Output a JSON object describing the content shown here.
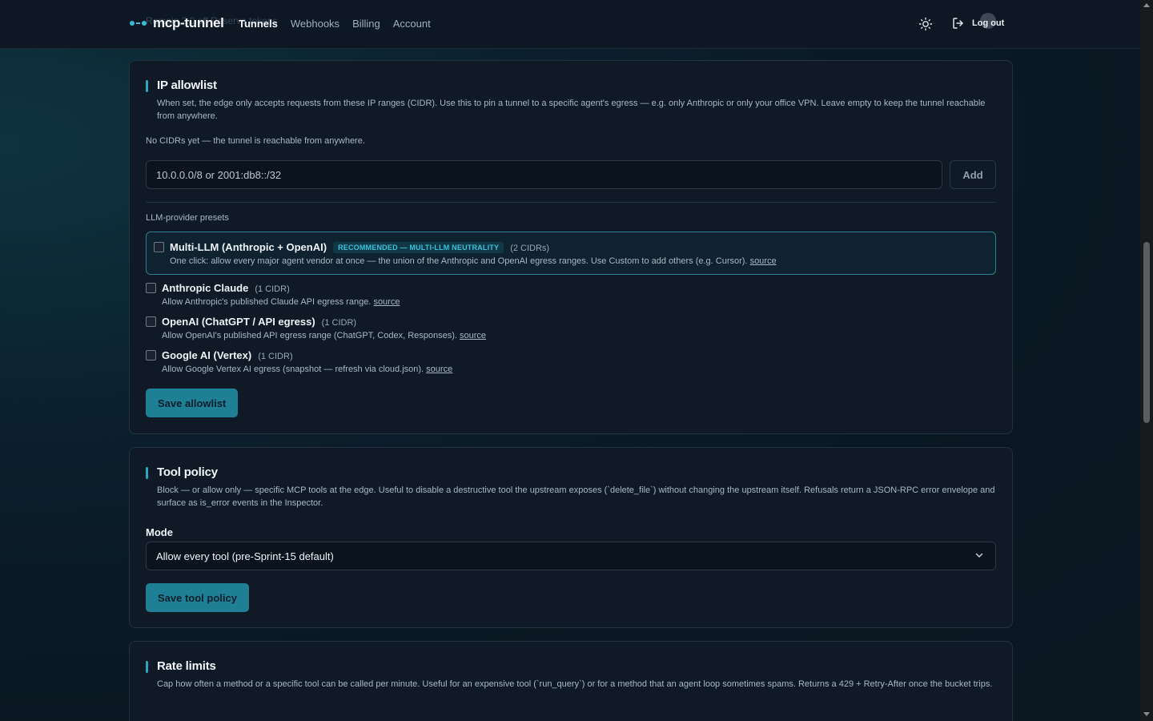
{
  "header": {
    "brand": "mcp-tunnel",
    "ghost_text": "Remain 2.0 off Reserve tokens",
    "nav": [
      {
        "label": "Tunnels",
        "active": true
      },
      {
        "label": "Webhooks",
        "active": false
      },
      {
        "label": "Billing",
        "active": false
      },
      {
        "label": "Account",
        "active": false
      }
    ],
    "theme_icon": "sun-icon",
    "logout_label": "Log out"
  },
  "ip_allowlist": {
    "title": "IP allowlist",
    "description": "When set, the edge only accepts requests from these IP ranges (CIDR). Use this to pin a tunnel to a specific agent's egress — e.g. only Anthropic or only your office VPN. Leave empty to keep the tunnel reachable from anywhere.",
    "empty_state": "No CIDRs yet — the tunnel is reachable from anywhere.",
    "input_placeholder": "10.0.0.0/8 or 2001:db8::/32",
    "add_label": "Add",
    "presets_heading": "LLM-provider presets",
    "presets": [
      {
        "name": "Multi-LLM (Anthropic + OpenAI)",
        "badge": "RECOMMENDED — MULTI-LLM NEUTRALITY",
        "count": "(2 CIDRs)",
        "description": "One click: allow every major agent vendor at once — the union of the Anthropic and OpenAI egress ranges. Use Custom to add others (e.g. Cursor).",
        "source_label": "source",
        "checked": false
      },
      {
        "name": "Anthropic Claude",
        "count": "(1 CIDR)",
        "description": "Allow Anthropic's published Claude API egress range.",
        "source_label": "source",
        "checked": false
      },
      {
        "name": "OpenAI (ChatGPT / API egress)",
        "count": "(1 CIDR)",
        "description": "Allow OpenAI's published API egress range (ChatGPT, Codex, Responses).",
        "source_label": "source",
        "checked": false
      },
      {
        "name": "Google AI (Vertex)",
        "count": "(1 CIDR)",
        "description": "Allow Google Vertex AI egress (snapshot — refresh via cloud.json).",
        "source_label": "source",
        "checked": false
      }
    ],
    "save_label": "Save allowlist"
  },
  "tool_policy": {
    "title": "Tool policy",
    "description": "Block — or allow only — specific MCP tools at the edge. Useful to disable a destructive tool the upstream exposes (`delete_file`) without changing the upstream itself. Refusals return a JSON-RPC error envelope and surface as is_error events in the Inspector.",
    "mode_label": "Mode",
    "mode_value": "Allow every tool (pre-Sprint-15 default)",
    "save_label": "Save tool policy"
  },
  "rate_limits": {
    "title": "Rate limits",
    "description": "Cap how often a method or a specific tool can be called per minute. Useful for an expensive tool (`run_query`) or for a method that an agent loop sometimes spams. Returns a 429 + Retry-After once the bucket trips."
  },
  "colors": {
    "accent": "#2aa6c2",
    "primary_button": "#1f7f95",
    "background": "#0a1722",
    "card": "#0f1a26"
  }
}
